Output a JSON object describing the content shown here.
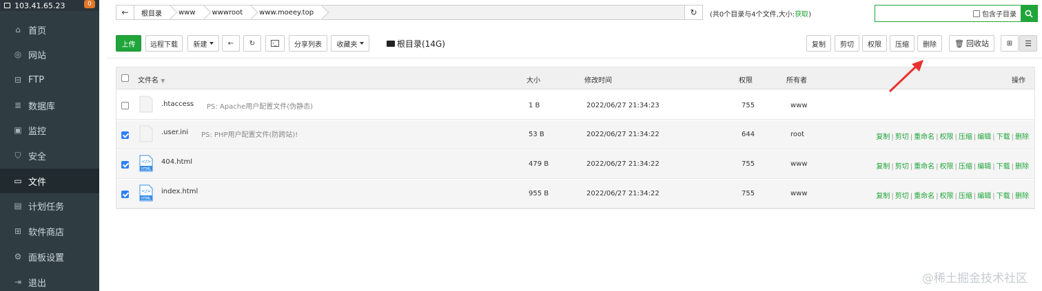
{
  "sidebar": {
    "server_ip": "103.41.65.23",
    "badge": "0",
    "items": [
      {
        "label": "首页",
        "icon": "home-icon"
      },
      {
        "label": "网站",
        "icon": "globe-icon"
      },
      {
        "label": "FTP",
        "icon": "ftp-icon"
      },
      {
        "label": "数据库",
        "icon": "database-icon"
      },
      {
        "label": "监控",
        "icon": "monitor-icon"
      },
      {
        "label": "安全",
        "icon": "shield-icon"
      },
      {
        "label": "文件",
        "icon": "folder-icon",
        "active": true
      },
      {
        "label": "计划任务",
        "icon": "calendar-icon"
      },
      {
        "label": "软件商店",
        "icon": "apps-icon"
      },
      {
        "label": "面板设置",
        "icon": "gear-icon"
      },
      {
        "label": "退出",
        "icon": "logout-icon"
      }
    ]
  },
  "address": {
    "crumbs": [
      "根目录",
      "www",
      "wwwroot",
      "www.moeey.top"
    ]
  },
  "summary": {
    "text": "(共0个目录与4个文件,大小:",
    "link": "获取",
    "tail": ")"
  },
  "search": {
    "include_sub_label": "包含子目录"
  },
  "toolbar": {
    "upload": "上传",
    "remote_download": "远程下载",
    "new": "新建",
    "share_list": "分享列表",
    "favorites": "收藏夹",
    "root_dir": "根目录(14G)",
    "copy": "复制",
    "cut": "剪切",
    "permission": "权限",
    "compress": "压缩",
    "delete": "删除",
    "recycle_bin": "回收站"
  },
  "table": {
    "headers": {
      "name": "文件名",
      "size": "大小",
      "mtime": "修改时间",
      "perm": "权限",
      "owner": "所有者",
      "ops": "操作"
    },
    "rows": [
      {
        "name": ".htaccess",
        "note": "PS: Apache用户配置文件(伪静态)",
        "size": "1 B",
        "mtime": "2022/06/27 21:34:23",
        "perm": "755",
        "owner": "www",
        "checked": false,
        "type": "file",
        "show_ops": false
      },
      {
        "name": ".user.ini",
        "note": "PS: PHP用户配置文件(防跨站)!",
        "size": "53 B",
        "mtime": "2022/06/27 21:34:22",
        "perm": "644",
        "owner": "root",
        "checked": true,
        "type": "file",
        "show_ops": true
      },
      {
        "name": "404.html",
        "note": "",
        "size": "479 B",
        "mtime": "2022/06/27 21:34:22",
        "perm": "755",
        "owner": "www",
        "checked": true,
        "type": "html",
        "show_ops": true
      },
      {
        "name": "index.html",
        "note": "",
        "size": "955 B",
        "mtime": "2022/06/27 21:34:22",
        "perm": "755",
        "owner": "www",
        "checked": true,
        "type": "html",
        "show_ops": true
      }
    ],
    "row_ops": [
      "复制",
      "剪切",
      "重命名",
      "权限",
      "压缩",
      "编辑",
      "下载",
      "删除"
    ]
  },
  "watermark": "@稀土掘金技术社区",
  "colors": {
    "accent_green": "#20a53a",
    "sidebar_bg": "#2f3d43",
    "checkbox_blue": "#2d7ff9",
    "arrow_red": "#e8322d"
  }
}
